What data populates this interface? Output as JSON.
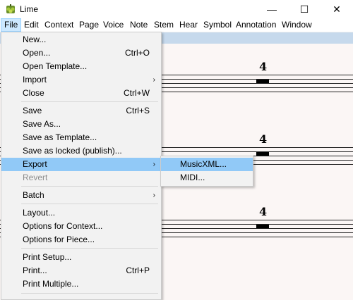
{
  "window": {
    "title": "Lime",
    "controls": {
      "minimize": "—",
      "maximize": "☐",
      "close": "✕"
    }
  },
  "menubar": {
    "items": [
      "File",
      "Edit",
      "Context",
      "Page",
      "Voice",
      "Note",
      "Stem",
      "Hear",
      "Symbol",
      "Annotation",
      "Window"
    ]
  },
  "file_menu": {
    "items": [
      {
        "label": "New...",
        "shortcut": ""
      },
      {
        "label": "Open...",
        "shortcut": "Ctrl+O"
      },
      {
        "label": "Open Template...",
        "shortcut": ""
      },
      {
        "label": "Import",
        "shortcut": "",
        "submenu": true
      },
      {
        "label": "Close",
        "shortcut": "Ctrl+W"
      },
      {
        "label": "Save",
        "shortcut": "Ctrl+S"
      },
      {
        "label": "Save As...",
        "shortcut": ""
      },
      {
        "label": "Save as Template...",
        "shortcut": ""
      },
      {
        "label": "Save as locked (publish)...",
        "shortcut": ""
      },
      {
        "label": "Export",
        "shortcut": "",
        "submenu": true,
        "highlighted": true
      },
      {
        "label": "Revert",
        "shortcut": "",
        "disabled": true
      },
      {
        "label": "Batch",
        "shortcut": "",
        "submenu": true
      },
      {
        "label": "Layout...",
        "shortcut": ""
      },
      {
        "label": "Options for Context...",
        "shortcut": ""
      },
      {
        "label": "Options for Piece...",
        "shortcut": ""
      },
      {
        "label": "Print Setup...",
        "shortcut": ""
      },
      {
        "label": "Print...",
        "shortcut": "Ctrl+P"
      },
      {
        "label": "Print Multiple...",
        "shortcut": ""
      }
    ]
  },
  "export_submenu": {
    "items": [
      {
        "label": "MusicXML...",
        "highlighted": true
      },
      {
        "label": "MIDI..."
      }
    ]
  },
  "score": {
    "time_signature": "4"
  },
  "colors": {
    "menu_highlight": "#91c9f7",
    "menubar_active": "#cce8ff",
    "page_background": "#fbf6f5"
  }
}
